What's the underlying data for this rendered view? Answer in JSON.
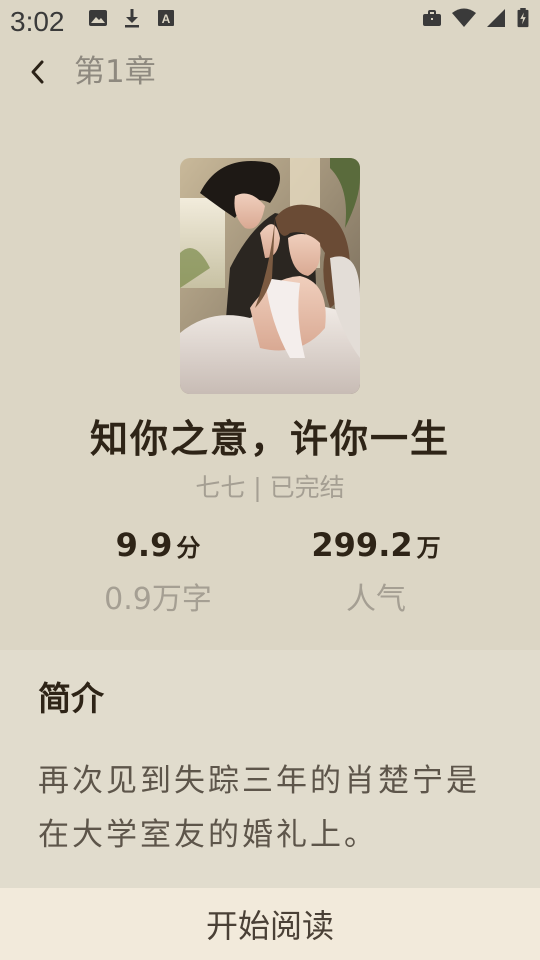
{
  "status_bar": {
    "time": "3:02",
    "left_icons": [
      "image-icon",
      "download-icon",
      "text-a-icon"
    ],
    "right_icons": [
      "briefcase-icon",
      "wifi-icon",
      "signal-icon",
      "battery-charging-icon"
    ]
  },
  "header": {
    "back_icon": "chevron-left-icon",
    "chapter": "第1章"
  },
  "book": {
    "title": "知你之意，许你一生",
    "meta": "七七 | 已完结",
    "rating_value": "9.9",
    "rating_unit": "分",
    "word_count": "0.9万字",
    "popularity_value": "299.2",
    "popularity_unit": "万",
    "popularity_label": "人气"
  },
  "intro": {
    "heading": "简介",
    "text": "再次见到失踪三年的肖楚宁是在大学室友的婚礼上。"
  },
  "action": {
    "read_label": "开始阅读"
  },
  "colors": {
    "background": "#dcd6c5",
    "intro_panel": "#e1dccd",
    "read_button": "#f2eadb",
    "title_text": "#2e2417",
    "muted_text": "#a59f93"
  }
}
